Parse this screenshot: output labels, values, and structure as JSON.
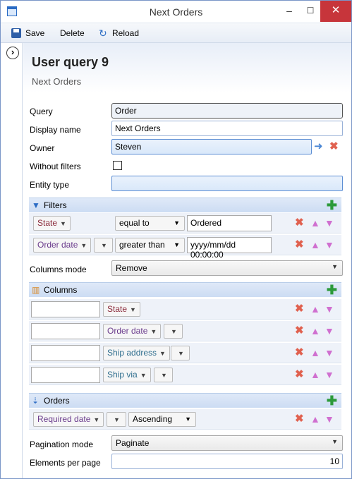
{
  "window": {
    "title": "Next Orders",
    "min_label": "‒",
    "max_label": "☐",
    "close_label": "✕"
  },
  "toolbar": {
    "save_label": "Save",
    "delete_label": "Delete",
    "reload_label": "Reload"
  },
  "header": {
    "title": "User query 9",
    "subtitle": "Next Orders"
  },
  "form": {
    "query_label": "Query",
    "query_value": "Order",
    "display_name_label": "Display name",
    "display_name_value": "Next Orders",
    "owner_label": "Owner",
    "owner_value": "Steven",
    "without_filters_label": "Without filters",
    "entity_type_label": "Entity type",
    "entity_type_value": ""
  },
  "filters": {
    "title": "Filters",
    "rows": [
      {
        "token": "State",
        "operation": "equal to",
        "value": "Ordered"
      },
      {
        "token": "Order date",
        "operation": "greater than",
        "value": "yyyy/mm/dd 00:00:00"
      }
    ]
  },
  "columns_mode": {
    "label": "Columns mode",
    "value": "Remove"
  },
  "columns": {
    "title": "Columns",
    "rows": [
      {
        "display": "",
        "token": "State"
      },
      {
        "display": "",
        "token": "Order date"
      },
      {
        "display": "",
        "token": "Ship address"
      },
      {
        "display": "",
        "token": "Ship via"
      }
    ]
  },
  "orders": {
    "title": "Orders",
    "rows": [
      {
        "token": "Required date",
        "direction": "Ascending"
      }
    ]
  },
  "pagination": {
    "label": "Pagination mode",
    "value": "Paginate"
  },
  "elements_per_page": {
    "label": "Elements per page",
    "value": "10"
  },
  "colors": {
    "accent": "#2a6bc4",
    "close": "#c7353b",
    "add": "#2c9a3a",
    "remove": "#e0614f",
    "move": "#d070d0"
  }
}
